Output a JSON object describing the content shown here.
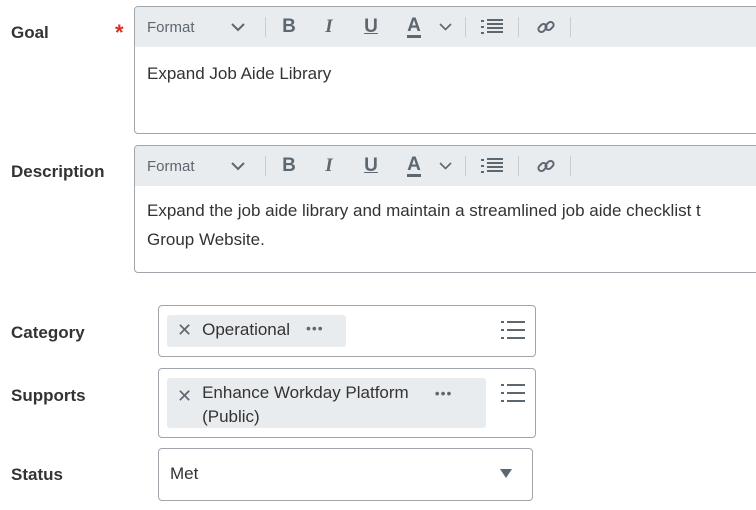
{
  "goal": {
    "label": "Goal",
    "required_marker": "*",
    "toolbar": {
      "format": "Format"
    },
    "value": "Expand Job Aide Library"
  },
  "description": {
    "label": "Description",
    "toolbar": {
      "format": "Format"
    },
    "value_line1": "Expand the job aide library and maintain a streamlined job aide checklist t",
    "value_line2": "Group Website."
  },
  "category": {
    "label": "Category",
    "pill": "Operational"
  },
  "supports": {
    "label": "Supports",
    "pill_line1": "Enhance Workday Platform",
    "pill_line2": "(Public)"
  },
  "status": {
    "label": "Status",
    "value": "Met"
  },
  "colors": {
    "required": "#de2e21",
    "toolbar_bg": "#e9ecee",
    "pill_bg": "#e9ecee",
    "border": "#a0a6ab"
  }
}
